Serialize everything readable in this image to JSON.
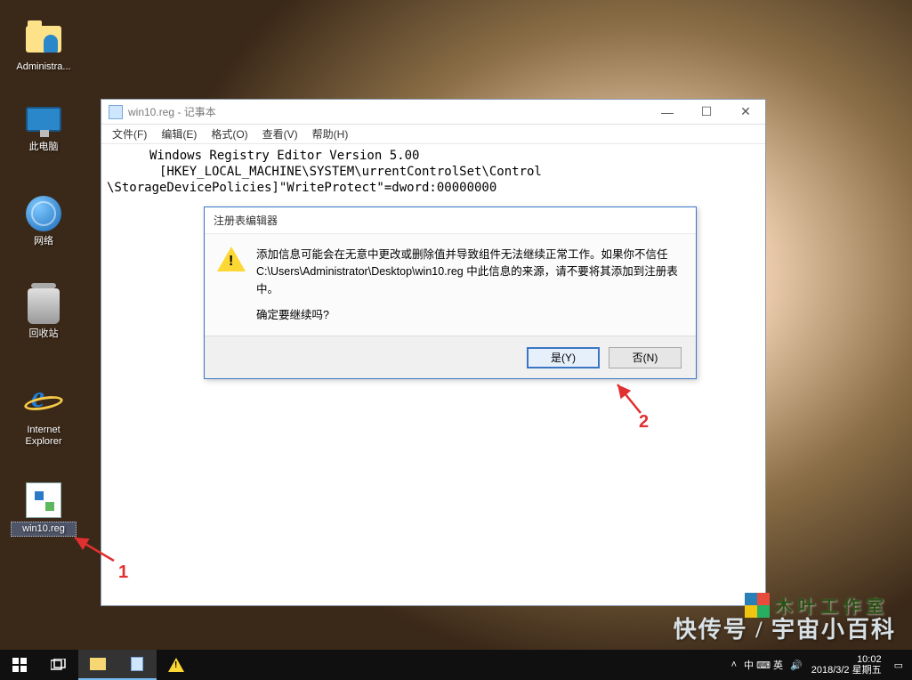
{
  "desktop": {
    "icons": [
      {
        "label": "Administra...",
        "type": "folder-person"
      },
      {
        "label": "此电脑",
        "type": "monitor"
      },
      {
        "label": "网络",
        "type": "globe"
      },
      {
        "label": "回收站",
        "type": "bin"
      },
      {
        "label": "Internet Explorer",
        "type": "ie"
      },
      {
        "label": "win10.reg",
        "type": "reg",
        "selected": true
      }
    ]
  },
  "notepad": {
    "title": "win10.reg - 记事本",
    "menu": [
      "文件(F)",
      "编辑(E)",
      "格式(O)",
      "查看(V)",
      "帮助(H)"
    ],
    "content_line1": "Windows Registry Editor Version 5.00",
    "content_line2": "       [HKEY_LOCAL_MACHINE\\SYSTEM\\urrentControlSet\\Control",
    "content_line3": "\\StorageDevicePolicies]\"WriteProtect\"=dword:00000000",
    "window_controls": {
      "min": "—",
      "max": "☐",
      "close": "✕"
    }
  },
  "dialog": {
    "title": "注册表编辑器",
    "body1": "添加信息可能会在无意中更改或删除值并导致组件无法继续正常工作。如果你不信任 C:\\Users\\Administrator\\Desktop\\win10.reg 中此信息的来源，请不要将其添加到注册表中。",
    "body2": "确定要继续吗?",
    "yes": "是(Y)",
    "no": "否(N)"
  },
  "annotations": {
    "n1": "1",
    "n2": "2"
  },
  "taskbar": {
    "lang": "中 ⌨ 英",
    "time": "10:02",
    "date": "2018/3/2 星期五"
  },
  "watermark": "快传号 / 宇宙小百科",
  "studio": "木 叶 工 作 室"
}
